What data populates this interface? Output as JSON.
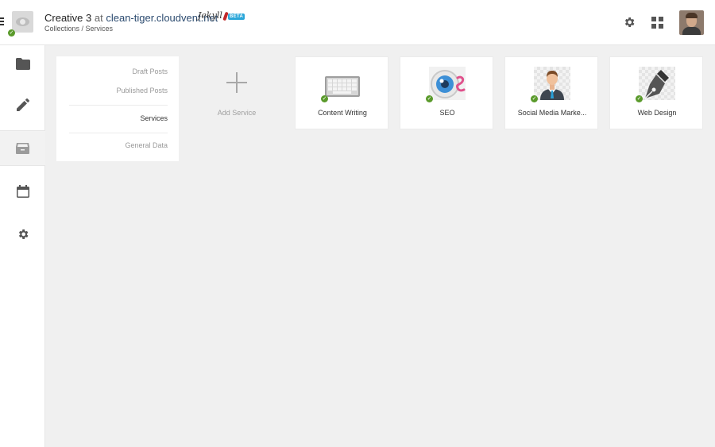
{
  "header": {
    "site_name": "Creative 3",
    "at_word": "at",
    "domain": "clean-tiger.cloudvent.net",
    "ssg_logo": "Jekyll",
    "beta_badge": "BETA",
    "breadcrumb": "Collections / Services",
    "icons": [
      "menu-icon",
      "site-thumbnail",
      "gear-icon",
      "apps-grid-icon",
      "avatar"
    ]
  },
  "rail": {
    "items": [
      {
        "name": "collections",
        "icon": "folder-icon"
      },
      {
        "name": "editor",
        "icon": "pencil-icon"
      },
      {
        "name": "files",
        "icon": "inbox-icon",
        "active": true
      },
      {
        "name": "schedule",
        "icon": "calendar-icon"
      },
      {
        "name": "settings",
        "icon": "gear-icon"
      }
    ]
  },
  "subnav": {
    "items": [
      {
        "label": "Draft Posts"
      },
      {
        "label": "Published Posts"
      },
      {
        "label": "Services",
        "current": true
      },
      {
        "label": "General Data"
      }
    ]
  },
  "add_service": {
    "label": "Add Service"
  },
  "cards": [
    {
      "label": "Content Writing",
      "icon": "keyboard-icon",
      "published": true
    },
    {
      "label": "SEO",
      "icon": "eye-icon",
      "published": true
    },
    {
      "label": "Social Media Marke...",
      "icon": "businessman-icon",
      "published": true
    },
    {
      "label": "Web Design",
      "icon": "pen-nib-icon",
      "published": true
    }
  ],
  "colors": {
    "accent_blue": "#2aa6d9",
    "published_green": "#5a9a2b",
    "domain_blue": "#2b4a6f",
    "background": "#f0f0f0"
  }
}
